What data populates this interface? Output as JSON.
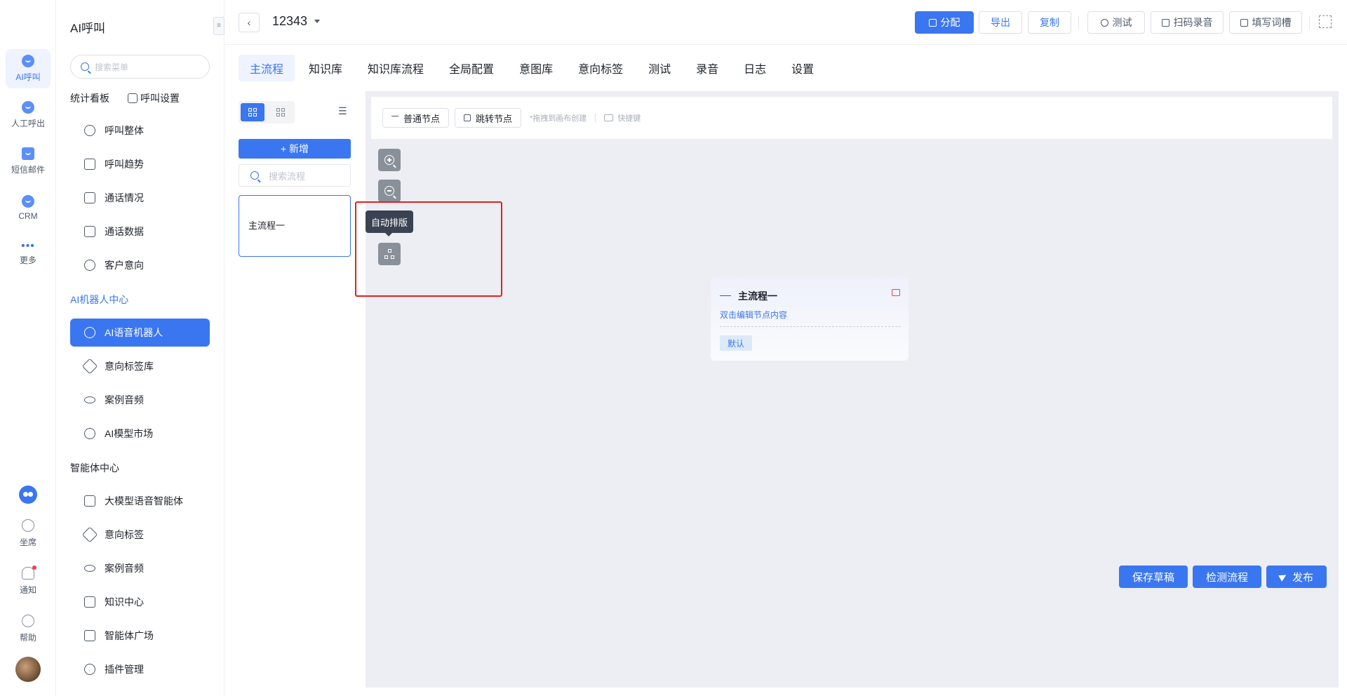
{
  "rail": {
    "items": [
      {
        "label": "AI呼叫",
        "icon": "robot-icon"
      },
      {
        "label": "人工呼出",
        "icon": "phone-icon"
      },
      {
        "label": "短信邮件",
        "icon": "message-icon"
      },
      {
        "label": "CRM",
        "icon": "crm-icon"
      },
      {
        "label": "更多",
        "icon": "more-icon"
      }
    ],
    "bottom": [
      {
        "label": "坐席",
        "icon": "headset-icon"
      },
      {
        "label": "通知",
        "icon": "bell-icon"
      },
      {
        "label": "帮助",
        "icon": "help-icon"
      }
    ]
  },
  "menu": {
    "title": "AI呼叫",
    "search_placeholder": "搜索菜单",
    "section_stats": "统计看板",
    "overlap_item": "呼叫设置",
    "stats_items": [
      "呼叫整体",
      "呼叫趋势",
      "通话情况",
      "通话数据",
      "客户意向"
    ],
    "section_robot": "AI机器人中心",
    "robot_items": [
      "AI语音机器人",
      "意向标签库",
      "案例音频",
      "AI模型市场"
    ],
    "section_agent": "智能体中心",
    "agent_items": [
      "大模型语音智能体",
      "意向标签",
      "案例音频",
      "知识中心",
      "智能体广场",
      "插件管理"
    ]
  },
  "header": {
    "back": "‹",
    "title": "12343",
    "buttons": {
      "assign": "分配",
      "export": "导出",
      "copy": "复制",
      "test": "测试",
      "scan_record": "扫码录音",
      "fill_slot": "填写词槽"
    }
  },
  "tabs": [
    "主流程",
    "知识库",
    "知识库流程",
    "全局配置",
    "意图库",
    "意向标签",
    "测试",
    "录音",
    "日志",
    "设置"
  ],
  "flow_panel": {
    "add_label": "+ 新增",
    "search_placeholder": "搜索流程",
    "flows": [
      "主流程一"
    ]
  },
  "canvas": {
    "toolbar": {
      "normal_node": "普通节点",
      "jump_node": "跳转节点",
      "drag_hint": "*拖拽到画布创建",
      "shortcut": "快捷键"
    },
    "tooltip": "自动排版",
    "node": {
      "title": "主流程一",
      "desc": "双击编辑节点内容",
      "tag": "默认"
    }
  },
  "footer": {
    "save_draft": "保存草稿",
    "check_flow": "检测流程",
    "publish": "发布"
  },
  "colors": {
    "primary": "#3a76f0",
    "highlight_box": "#e02020",
    "canvas_bg": "#eceef3"
  }
}
